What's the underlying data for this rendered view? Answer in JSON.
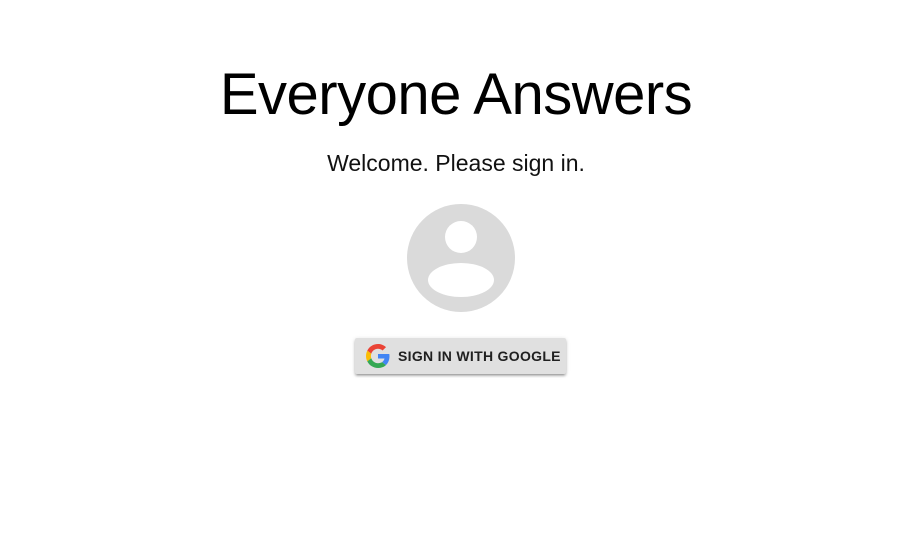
{
  "app": {
    "title": "Everyone Answers",
    "subtitle": "Welcome. Please sign in."
  },
  "avatar": {
    "icon": "account-circle-icon",
    "color": "#dadada"
  },
  "sign_in": {
    "button_label": "SIGN IN WITH GOOGLE",
    "icon": "google-logo-icon",
    "button_color": "#e0e0e0"
  }
}
